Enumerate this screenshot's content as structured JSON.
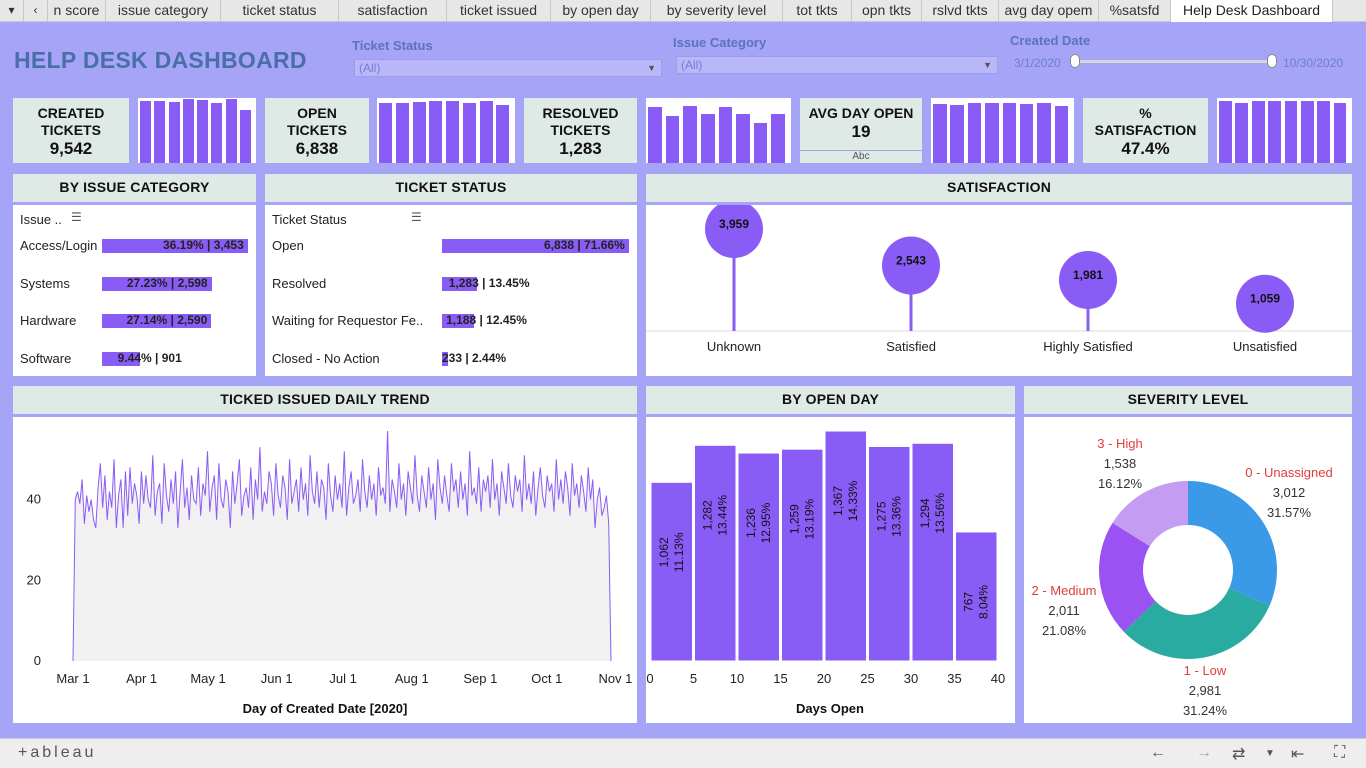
{
  "tabs": {
    "controls": [
      "▾",
      "‹"
    ],
    "items": [
      "n score",
      "issue category",
      "ticket status",
      "satisfaction",
      "ticket issued",
      "by open day",
      "by severity level",
      "tot tkts",
      "opn tkts",
      "rslvd tkts",
      "avg day opem",
      "%satsfd",
      "Help Desk Dashboard"
    ],
    "active": "Help Desk Dashboard"
  },
  "title": "HELP DESK DASHBOARD",
  "filters": {
    "ticket_status": {
      "label": "Ticket Status",
      "value": "(All)"
    },
    "issue_category": {
      "label": "Issue Category",
      "value": "(All)"
    },
    "created_date": {
      "label": "Created Date",
      "start": "3/1/2020",
      "end": "10/30/2020"
    }
  },
  "kpis": {
    "created": {
      "label1": "CREATED",
      "label2": "TICKETS",
      "value": "9,542"
    },
    "open": {
      "label1": "OPEN",
      "label2": "TICKETS",
      "value": "6,838"
    },
    "resolved": {
      "label1": "RESOLVED",
      "label2": "TICKETS",
      "value": "1,283"
    },
    "avg": {
      "label1": "AVG DAY OPEN",
      "value": "19",
      "sub": "Abc"
    },
    "satisfaction": {
      "label1": "%",
      "label2": "SATISFACTION",
      "value": "47.4%"
    }
  },
  "sparklines": {
    "created": [
      0.95,
      0.95,
      0.94,
      0.98,
      0.97,
      0.92,
      0.98,
      0.82
    ],
    "open": [
      0.92,
      0.92,
      0.94,
      0.95,
      0.95,
      0.93,
      0.95,
      0.9
    ],
    "resolved": [
      0.86,
      0.72,
      0.88,
      0.76,
      0.86,
      0.76,
      0.62,
      0.76
    ],
    "satisfaction": [
      0.95,
      0.93,
      0.96,
      0.96,
      0.96,
      0.95,
      0.96,
      0.92
    ]
  },
  "issue_category": {
    "title": "BY ISSUE CATEGORY",
    "col_header": "Issue ..",
    "rows": [
      {
        "name": "Access/Login",
        "pct": 36.19,
        "label": "36.19% | 3,453"
      },
      {
        "name": "Systems",
        "pct": 27.23,
        "label": "27.23% | 2,598"
      },
      {
        "name": "Hardware",
        "pct": 27.14,
        "label": "27.14% | 2,590"
      },
      {
        "name": "Software",
        "pct": 9.44,
        "label": "9.44% | 901"
      }
    ]
  },
  "ticket_status": {
    "title": "TICKET STATUS",
    "col_header": "Ticket Status",
    "rows": [
      {
        "name": "Open",
        "pct": 71.66,
        "label": "6,838 | 71.66%"
      },
      {
        "name": "Resolved",
        "pct": 13.45,
        "label": "1,283 | 13.45%"
      },
      {
        "name": "Waiting for Requestor Fe..",
        "pct": 12.45,
        "label": "1,188 | 12.45%"
      },
      {
        "name": "Closed - No Action",
        "pct": 2.44,
        "label": "233 | 2.44%"
      }
    ]
  },
  "satisfaction": {
    "title": "SATISFACTION",
    "items": [
      {
        "name": "Unknown",
        "value": 3959,
        "label": "3,959"
      },
      {
        "name": "Satisfied",
        "value": 2543,
        "label": "2,543"
      },
      {
        "name": "Highly Satisfied",
        "value": 1981,
        "label": "1,981"
      },
      {
        "name": "Unsatisfied",
        "value": 1059,
        "label": "1,059"
      }
    ]
  },
  "chart_data": [
    {
      "type": "line",
      "title": "TICKED ISSUED DAILY TREND",
      "xlabel": "Day of Created Date [2020]",
      "ylabel": "",
      "x_ticks": [
        "Mar 1",
        "Apr 1",
        "May 1",
        "Jun 1",
        "Jul 1",
        "Aug 1",
        "Sep 1",
        "Oct 1",
        "Nov 1"
      ],
      "y_ticks": [
        0,
        20,
        40
      ],
      "ylim": [
        0,
        58
      ],
      "x_range": [
        "2020-03-01",
        "2020-10-30"
      ],
      "values": [
        0,
        40,
        42,
        39,
        45,
        34,
        41,
        37,
        40,
        35,
        33,
        43,
        49,
        38,
        46,
        35,
        42,
        38,
        50,
        33,
        41,
        45,
        33,
        47,
        36,
        48,
        39,
        44,
        41,
        34,
        47,
        39,
        46,
        40,
        38,
        51,
        36,
        42,
        44,
        34,
        49,
        41,
        37,
        45,
        39,
        47,
        33,
        42,
        50,
        38,
        43,
        35,
        46,
        40,
        39,
        48,
        36,
        44,
        41,
        52,
        37,
        43,
        46,
        35,
        49,
        40,
        38,
        45,
        42,
        33,
        47,
        39,
        44,
        50,
        36,
        41,
        43,
        38,
        48,
        35,
        45,
        40,
        53,
        37,
        42,
        39,
        47,
        44,
        36,
        49,
        41,
        38,
        46,
        43,
        35,
        50,
        39,
        42,
        45,
        37,
        48,
        40,
        44,
        36,
        51,
        42,
        39,
        47,
        38,
        45,
        43,
        35,
        49,
        41,
        37,
        46,
        40,
        44,
        38,
        52,
        36,
        43,
        47,
        39,
        41,
        45,
        37,
        50,
        42,
        38,
        46,
        40,
        44,
        36,
        48,
        41,
        43,
        39,
        57,
        37,
        45,
        42,
        38,
        49,
        40,
        44,
        36,
        47,
        43,
        39,
        51,
        41,
        37,
        46,
        42,
        38,
        48,
        40,
        44,
        35,
        50,
        43,
        39,
        46,
        41,
        37,
        49,
        42,
        45,
        38,
        47,
        40,
        44,
        36,
        52,
        41,
        43,
        39,
        48,
        37,
        45,
        42,
        46,
        38,
        50,
        40,
        44,
        36,
        47,
        43,
        39,
        49,
        41,
        38,
        46,
        42,
        45,
        37,
        51,
        40,
        44,
        39,
        47,
        36,
        43,
        48,
        41,
        38,
        46,
        42,
        44,
        37,
        50,
        40,
        45,
        39,
        47,
        43,
        36,
        49,
        41,
        44,
        38,
        46,
        42,
        37,
        48,
        40,
        45,
        33,
        40,
        43,
        36,
        38,
        41,
        34,
        0
      ]
    },
    {
      "type": "bar",
      "title": "BY OPEN DAY",
      "xlabel": "Days Open",
      "x_ticks": [
        0,
        5,
        10,
        15,
        20,
        25,
        30,
        35,
        40
      ],
      "bins": [
        [
          0,
          5
        ],
        [
          5,
          10
        ],
        [
          10,
          15
        ],
        [
          15,
          20
        ],
        [
          20,
          25
        ],
        [
          25,
          30
        ],
        [
          30,
          35
        ],
        [
          35,
          40
        ]
      ],
      "values": [
        1062,
        1282,
        1236,
        1259,
        1367,
        1275,
        1294,
        767
      ],
      "labels": [
        "1,062",
        "1,282",
        "1,236",
        "1,259",
        "1,367",
        "1,275",
        "1,294",
        "767"
      ],
      "percents": [
        "11.13%",
        "13.44%",
        "12.95%",
        "13.19%",
        "14.33%",
        "13.36%",
        "13.56%",
        "8.04%"
      ]
    },
    {
      "type": "pie",
      "title": "SEVERITY LEVEL",
      "slices": [
        {
          "name": "0 - Unassigned",
          "value": 3012,
          "label": "3,012",
          "pct": "31.57%",
          "color": "#3a9ae8"
        },
        {
          "name": "1 - Low",
          "value": 2981,
          "label": "2,981",
          "pct": "31.24%",
          "color": "#2aaba1"
        },
        {
          "name": "2 - Medium",
          "value": 2011,
          "label": "2,011",
          "pct": "21.08%",
          "color": "#9a52f2"
        },
        {
          "name": "3 - High",
          "value": 1538,
          "label": "1,538",
          "pct": "16.12%",
          "color": "#c49cf2"
        }
      ]
    }
  ],
  "footer": {
    "logo": "+ableau"
  },
  "colors": {
    "accent": "#8a5cf6",
    "background": "#a6a4f7",
    "header": "#dfe9e5",
    "title": "#4a6fa8",
    "severity_label": "#e03c3c"
  }
}
